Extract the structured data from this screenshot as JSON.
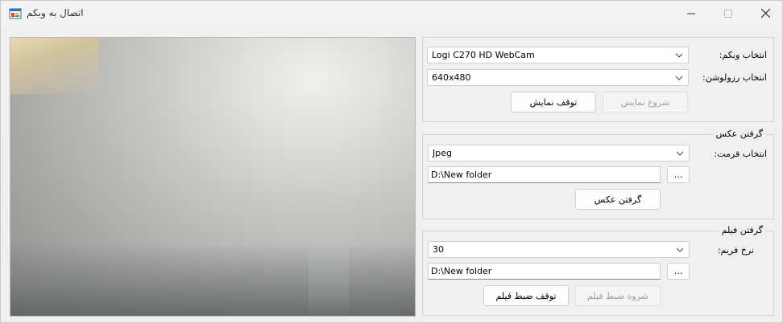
{
  "window": {
    "title": "اتصال به وبکم"
  },
  "webcam": {
    "device_label": "انتخاب وبکم:",
    "device_value": "Logi C270 HD WebCam",
    "resolution_label": "انتخاب رزولوشن:",
    "resolution_value": "640x480",
    "start_button": "شروع نمایش",
    "stop_button": "توقف نمایش"
  },
  "photo": {
    "caption": "گرفتن عکس",
    "format_label": "انتخاب فرمت:",
    "format_value": "Jpeg",
    "path_value": "D:\\New folder",
    "browse_button": "...",
    "capture_button": "گرفتن عکس"
  },
  "video": {
    "caption": "گرفتن فیلم",
    "framerate_label": "نرخ فریم:",
    "framerate_value": "30",
    "path_value": "D:\\New folder",
    "browse_button": "...",
    "start_button": "شروه ضبط فیلم",
    "stop_button": "توقف ضبط فیلم"
  }
}
